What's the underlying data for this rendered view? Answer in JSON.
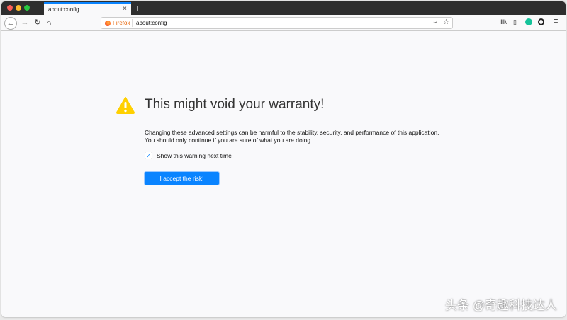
{
  "tab": {
    "title": "about:config",
    "close": "×",
    "new_tab": "+"
  },
  "toolbar": {
    "back": "←",
    "forward": "→",
    "reload": "↻",
    "home": "⌂",
    "identity": "Firefox",
    "url": "about:config",
    "dropdown": "⌄",
    "bookmark": "☆",
    "library": "Ⅲ\\",
    "sidebar": "▯",
    "menu": "≡"
  },
  "page": {
    "title": "This might void your warranty!",
    "line1": "Changing these advanced settings can be harmful to the stability, security, and performance of this application.",
    "line2": "You should only continue if you are sure of what you are doing.",
    "checkbox_label": "Show this warning next time",
    "checkbox_checked": true,
    "checkmark": "✓",
    "button": "I accept the risk!"
  },
  "watermark": "头条 @奇趣科技达人",
  "colors": {
    "accent": "#0a84ff",
    "warning": "#ffd000"
  }
}
